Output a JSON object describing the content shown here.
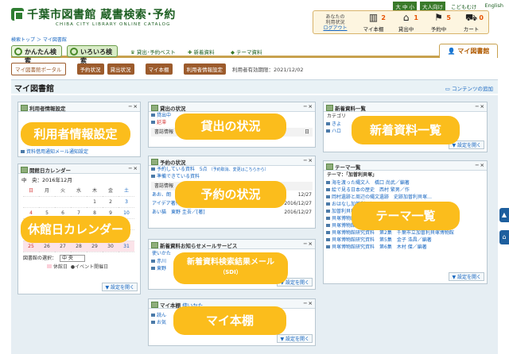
{
  "header": {
    "title": "千葉市図書館 蔵書検索･予約",
    "subtitle": "CHIBA CITY LIBRARY ONLINE CATALOG",
    "font_size_label": "大 中 小",
    "links": [
      "大人向け",
      "こどもむけ",
      "English"
    ],
    "user_info_1": "あなたの",
    "user_info_2": "利用状況",
    "user_info_3": "（スポット）",
    "logout": "ログアウト",
    "items": [
      {
        "label": "マイ本棚",
        "count": "2",
        "icon": "books-icon",
        "glyph": "📚"
      },
      {
        "label": "貸出中",
        "count": "1",
        "icon": "house-icon",
        "glyph": "🏠"
      },
      {
        "label": "予約中",
        "count": "5",
        "icon": "flag-icon",
        "glyph": "⚑"
      },
      {
        "label": "カート",
        "count": "0",
        "icon": "cart-icon",
        "glyph": "🛒"
      }
    ]
  },
  "breadcrumb": "検索トップ ＞ マイ図書館",
  "tabs": {
    "simple": "かんたん検索",
    "detailed": "いろいろ検索",
    "links": [
      "貸出･予約ベスト",
      "新着資料",
      "テーマ資料"
    ],
    "mylib": "マイ図書館"
  },
  "subnav": {
    "portal": "マイ図書館ポータル",
    "reserve": "予約状況",
    "loan": "貸出状況",
    "shelf": "マイ本棚",
    "userinfo": "利用者情報設定",
    "expire": "利用者有効期限：2021/12/02"
  },
  "page": {
    "title": "マイ図書館",
    "add_content": "コンテンツの追加"
  },
  "panels": {
    "userinfo": {
      "title": "利用者情報設定",
      "row": "資料借用通知メール通知設定"
    },
    "calendar": {
      "title": "開館日カレンダー",
      "month": "中　央：2016年12月",
      "weekdays": [
        "日",
        "月",
        "火",
        "水",
        "木",
        "金",
        "土"
      ],
      "rows": [
        [
          "",
          "",
          "",
          "",
          "1",
          "2",
          "3"
        ],
        [
          "4",
          "5",
          "6",
          "7",
          "8",
          "9",
          "10"
        ],
        [
          "11",
          "12",
          "13",
          "14",
          "15",
          "16",
          "17"
        ],
        [
          "18",
          "19",
          "20",
          "21",
          "22",
          "23",
          "24"
        ],
        [
          "25",
          "26",
          "27",
          "28",
          "29",
          "30",
          "31"
        ]
      ],
      "select_label": "図書館の選択：",
      "select_value": "中 央",
      "legend_closed": "休館日",
      "legend_event": "イベント開催日",
      "more": "設定を開く"
    },
    "loan": {
      "title": "貸出の状況",
      "row1": "貸出中",
      "row2": "延滞",
      "row3": "書誌情報",
      "row3_date": "日"
    },
    "reserve": {
      "title": "予約の状況",
      "row1": "予約している資料　5点",
      "row1_note": "（予約取消、変更はこちらから）",
      "row2": "準備できている資料",
      "header": "書誌情報",
      "items": [
        {
          "text": "あお、朗",
          "date": "12/27"
        },
        {
          "text": "アイデア著作権を貰う350日　豊文 書…",
          "date": "2016/12/27"
        },
        {
          "text": "あい猫　東野 圭吾／[著]",
          "date": "2016/12/27"
        }
      ]
    },
    "newmail": {
      "title": "新着資料お知らせメールサービス",
      "row0": "使いかた",
      "row1": "赤川",
      "row2": "東野",
      "more": "設定を開く"
    },
    "shelf": {
      "title": "マイ本棚",
      "howto": "使いかた",
      "row1": "読ん",
      "row2": "お気",
      "more": "設定を開く"
    },
    "newbooks": {
      "title": "新着資料一覧",
      "category": "カテゴリ",
      "row1": "きよ",
      "row2": "ハロ",
      "more": "設定を開く"
    },
    "theme": {
      "title": "テーマ一覧",
      "theme_label": "テーマ：「加曽利貝塚」",
      "items": [
        "海を渡った縄文人　橋口 尚武／編著",
        "絵で見る日本の歴史　西村 繁男／作",
        "岡村遺跡と周辺の縄文遺跡　史跡加曽利貝塚…",
        "おはなし加曽利貝塚",
        "加曽利貝塚と縄文時代",
        "貝塚博物館紀要　第17号",
        "貝塚博物館紀要　第23号　千葉市立加曽利貝塚博物館",
        "貝塚博物館研究資料　第2集　千葉市立加曽利貝塚博物館",
        "貝塚博物館研究資料　第5集　金子 浩昌／編著",
        "貝塚博物館研究資料　第6集　木村 傑／編著"
      ],
      "more": "設定を開く"
    }
  },
  "overlays": {
    "userinfo": "利用者情報設定",
    "calendar": "休館日カレンダー",
    "loan": "貸出の状況",
    "reserve": "予約の状況",
    "newmail_1": "新着資料検索結果メール",
    "newmail_2": "（SDI）",
    "shelf": "マイ本棚",
    "newbooks": "新着資料一覧",
    "theme": "テーマ一覧"
  },
  "colors": {
    "accent_green": "#1b5e20",
    "brown_button": "#9c5b2c",
    "overlay_yellow": "#fbbd1c",
    "panel_bg": "#e6eef3"
  }
}
